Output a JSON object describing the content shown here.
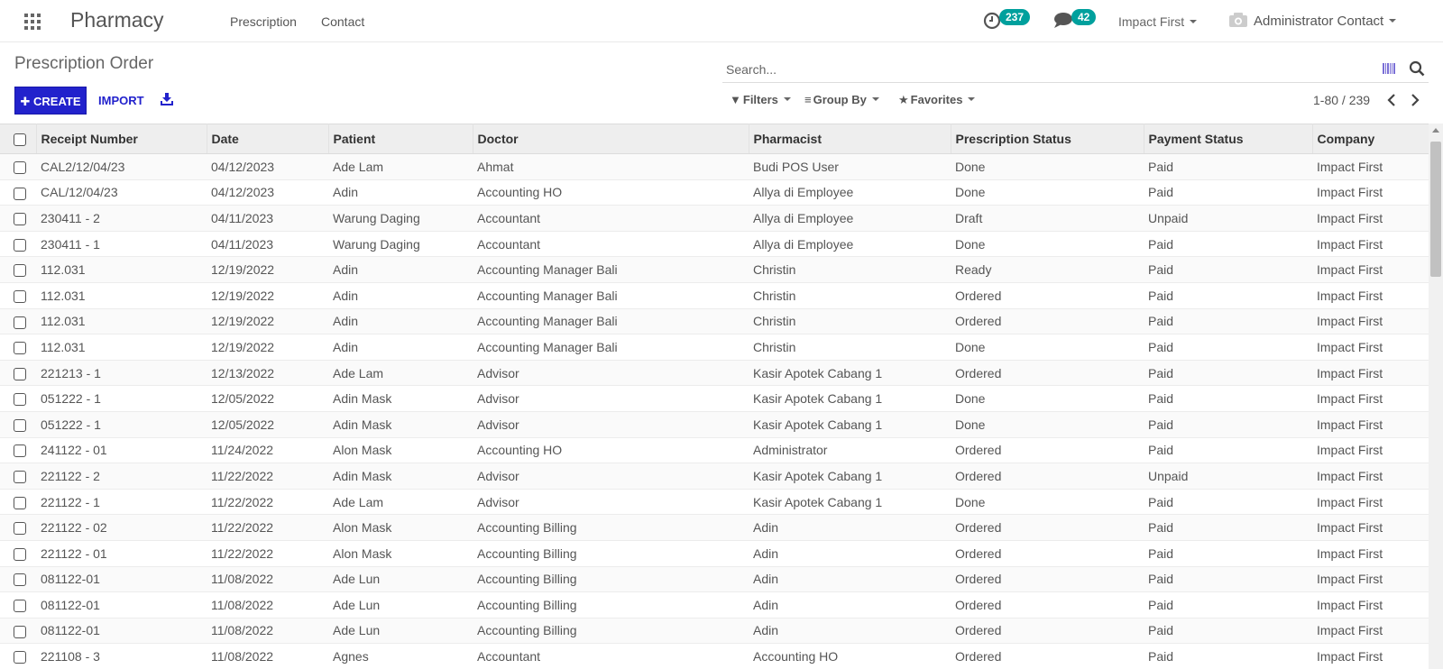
{
  "navbar": {
    "brand": "Pharmacy",
    "menu": [
      "Prescription",
      "Contact"
    ],
    "activity_count": "237",
    "message_count": "42",
    "company": "Impact First",
    "user": "Administrator Contact"
  },
  "control_panel": {
    "title": "Prescription Order",
    "create_label": "CREATE",
    "import_label": "IMPORT",
    "search_placeholder": "Search...",
    "filters_label": "Filters",
    "groupby_label": "Group By",
    "favorites_label": "Favorites",
    "pager": "1-80 / 239"
  },
  "table": {
    "columns": [
      "Receipt Number",
      "Date",
      "Patient",
      "Doctor",
      "Pharmacist",
      "Prescription Status",
      "Payment Status",
      "Company"
    ],
    "rows": [
      [
        "CAL2/12/04/23",
        "04/12/2023",
        "Ade Lam",
        "Ahmat",
        "Budi POS User",
        "Done",
        "Paid",
        "Impact First"
      ],
      [
        "CAL/12/04/23",
        "04/12/2023",
        "Adin",
        "Accounting HO",
        "Allya di Employee",
        "Done",
        "Paid",
        "Impact First"
      ],
      [
        "230411 - 2",
        "04/11/2023",
        "Warung Daging",
        "Accountant",
        "Allya di Employee",
        "Draft",
        "Unpaid",
        "Impact First"
      ],
      [
        "230411 - 1",
        "04/11/2023",
        "Warung Daging",
        "Accountant",
        "Allya di Employee",
        "Done",
        "Paid",
        "Impact First"
      ],
      [
        "112.031",
        "12/19/2022",
        "Adin",
        "Accounting Manager Bali",
        "Christin",
        "Ready",
        "Paid",
        "Impact First"
      ],
      [
        "112.031",
        "12/19/2022",
        "Adin",
        "Accounting Manager Bali",
        "Christin",
        "Ordered",
        "Paid",
        "Impact First"
      ],
      [
        "112.031",
        "12/19/2022",
        "Adin",
        "Accounting Manager Bali",
        "Christin",
        "Ordered",
        "Paid",
        "Impact First"
      ],
      [
        "112.031",
        "12/19/2022",
        "Adin",
        "Accounting Manager Bali",
        "Christin",
        "Done",
        "Paid",
        "Impact First"
      ],
      [
        "221213 - 1",
        "12/13/2022",
        "Ade Lam",
        "Advisor",
        "Kasir Apotek Cabang 1",
        "Ordered",
        "Paid",
        "Impact First"
      ],
      [
        "051222 - 1",
        "12/05/2022",
        "Adin Mask",
        "Advisor",
        "Kasir Apotek Cabang 1",
        "Done",
        "Paid",
        "Impact First"
      ],
      [
        "051222 - 1",
        "12/05/2022",
        "Adin Mask",
        "Advisor",
        "Kasir Apotek Cabang 1",
        "Done",
        "Paid",
        "Impact First"
      ],
      [
        "241122 - 01",
        "11/24/2022",
        "Alon Mask",
        "Accounting HO",
        "Administrator",
        "Ordered",
        "Paid",
        "Impact First"
      ],
      [
        "221122 - 2",
        "11/22/2022",
        "Adin Mask",
        "Advisor",
        "Kasir Apotek Cabang 1",
        "Ordered",
        "Unpaid",
        "Impact First"
      ],
      [
        "221122 - 1",
        "11/22/2022",
        "Ade Lam",
        "Advisor",
        "Kasir Apotek Cabang 1",
        "Done",
        "Paid",
        "Impact First"
      ],
      [
        "221122 - 02",
        "11/22/2022",
        "Alon Mask",
        "Accounting Billing",
        "Adin",
        "Ordered",
        "Paid",
        "Impact First"
      ],
      [
        "221122 - 01",
        "11/22/2022",
        "Alon Mask",
        "Accounting Billing",
        "Adin",
        "Ordered",
        "Paid",
        "Impact First"
      ],
      [
        "081122-01",
        "11/08/2022",
        "Ade Lun",
        "Accounting Billing",
        "Adin",
        "Ordered",
        "Paid",
        "Impact First"
      ],
      [
        "081122-01",
        "11/08/2022",
        "Ade Lun",
        "Accounting Billing",
        "Adin",
        "Ordered",
        "Paid",
        "Impact First"
      ],
      [
        "081122-01",
        "11/08/2022",
        "Ade Lun",
        "Accounting Billing",
        "Adin",
        "Ordered",
        "Paid",
        "Impact First"
      ],
      [
        "221108 - 3",
        "11/08/2022",
        "Agnes",
        "Accountant",
        "Accounting HO",
        "Ordered",
        "Paid",
        "Impact First"
      ]
    ]
  },
  "colors": {
    "primary": "#2222cc",
    "badge": "#00a09d"
  }
}
